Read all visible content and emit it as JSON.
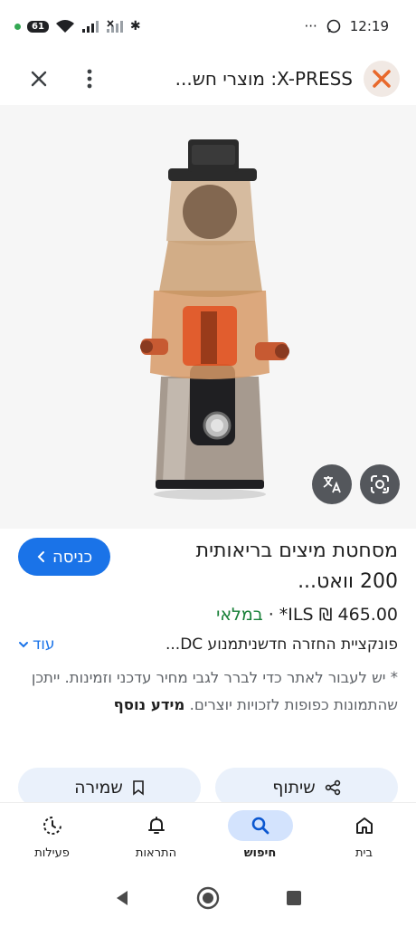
{
  "status_bar": {
    "battery": "61",
    "time": "12:19",
    "more": "···"
  },
  "header": {
    "title": "X-PRESS: מוצרי חש..."
  },
  "product": {
    "title": "מסחטת מיצים בריאותית 200 וואט...",
    "visit_label": "כניסה",
    "price": "465.00 ₪ ILS*",
    "separator": "·",
    "availability": "במלאי",
    "description": "פונקציית החזרה חדשניתמנוע DC...",
    "more_label": "עוד",
    "note": "* יש לעבור לאתר כדי לברר לגבי מחיר עדכני וזמינות. ייתכן שהתמונות כפופות לזכויות יוצרים.",
    "note_link": "מידע נוסף"
  },
  "actions": {
    "share_label": "שיתוף",
    "save_label": "שמירה"
  },
  "bottom_nav": {
    "items": [
      {
        "label": "בית",
        "icon": "home-icon"
      },
      {
        "label": "חיפוש",
        "icon": "search-icon",
        "active": true
      },
      {
        "label": "התראות",
        "icon": "bell-icon"
      },
      {
        "label": "פעילות",
        "icon": "activity-icon"
      }
    ]
  },
  "colors": {
    "accent": "#1a73e8",
    "in_stock": "#188038",
    "pill_bg": "#eaf1fb",
    "nav_active_bg": "#d3e3fd"
  }
}
